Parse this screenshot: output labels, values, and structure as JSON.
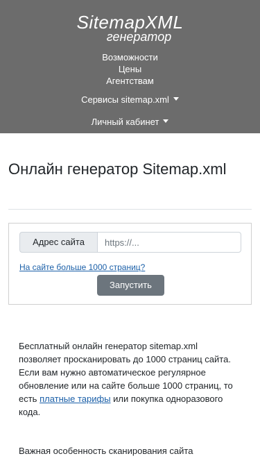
{
  "logo": {
    "title": "SitemapXML",
    "subtitle": "генератор"
  },
  "nav": {
    "items": [
      {
        "label": "Возможности"
      },
      {
        "label": "Цены"
      },
      {
        "label": "Агентствам"
      }
    ],
    "dropdowns": [
      {
        "label": "Сервисы sitemap.xml",
        "icon": "caret-down-icon"
      },
      {
        "label": "Личный кабинет",
        "icon": "caret-down-icon"
      }
    ]
  },
  "page": {
    "title": "Онлайн генератор Sitemap.xml"
  },
  "form": {
    "addon_label": "Адрес сайта",
    "url_value": "",
    "url_placeholder": "https://...",
    "more_link": "На сайте больше 1000 страниц?",
    "run_button": "Запустить"
  },
  "content": {
    "para1_before": "Бесплатный онлайн генератор sitemap.xml позволяет просканировать до 1000 страниц сайта. Если вам нужно автоматическое регулярное обновление или на сайте больше 1000 страниц, то есть ",
    "para1_link": "платные тарифы",
    "para1_after": " или покупка одноразового кода.",
    "para2": "Важная особенность сканирования сайта"
  },
  "colors": {
    "header_bg": "#6c6c6c",
    "button_bg": "#6c757d",
    "link": "#1a5fa8"
  }
}
